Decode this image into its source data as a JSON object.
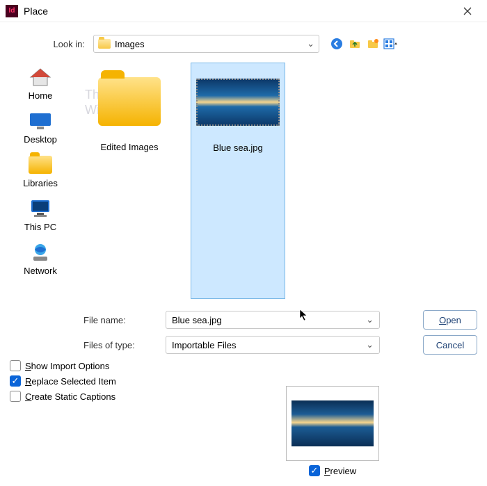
{
  "window": {
    "title": "Place"
  },
  "lookin": {
    "label": "Look in:",
    "value": "Images"
  },
  "watermark": {
    "line1": "The",
    "line2": "WindowsClub"
  },
  "sidebar": {
    "items": [
      {
        "label": "Home"
      },
      {
        "label": "Desktop"
      },
      {
        "label": "Libraries"
      },
      {
        "label": "This PC"
      },
      {
        "label": "Network"
      }
    ]
  },
  "files": [
    {
      "label": "Edited Images",
      "type": "folder"
    },
    {
      "label": "Blue sea.jpg",
      "type": "image",
      "selected": true
    }
  ],
  "form": {
    "filename_label": "File name:",
    "filename_value": "Blue sea.jpg",
    "filetype_label": "Files of type:",
    "filetype_value": "Importable Files",
    "open_label": "Open",
    "cancel_label": "Cancel"
  },
  "options": {
    "show_import": {
      "label": "Show Import Options",
      "checked": false
    },
    "replace_selected": {
      "label": "Replace Selected Item",
      "checked": true
    },
    "create_captions": {
      "label": "Create Static Captions",
      "checked": false
    },
    "preview": {
      "label": "Preview",
      "checked": true
    }
  },
  "nav_icons": [
    "back-icon",
    "up-icon",
    "new-folder-icon",
    "view-menu-icon"
  ]
}
